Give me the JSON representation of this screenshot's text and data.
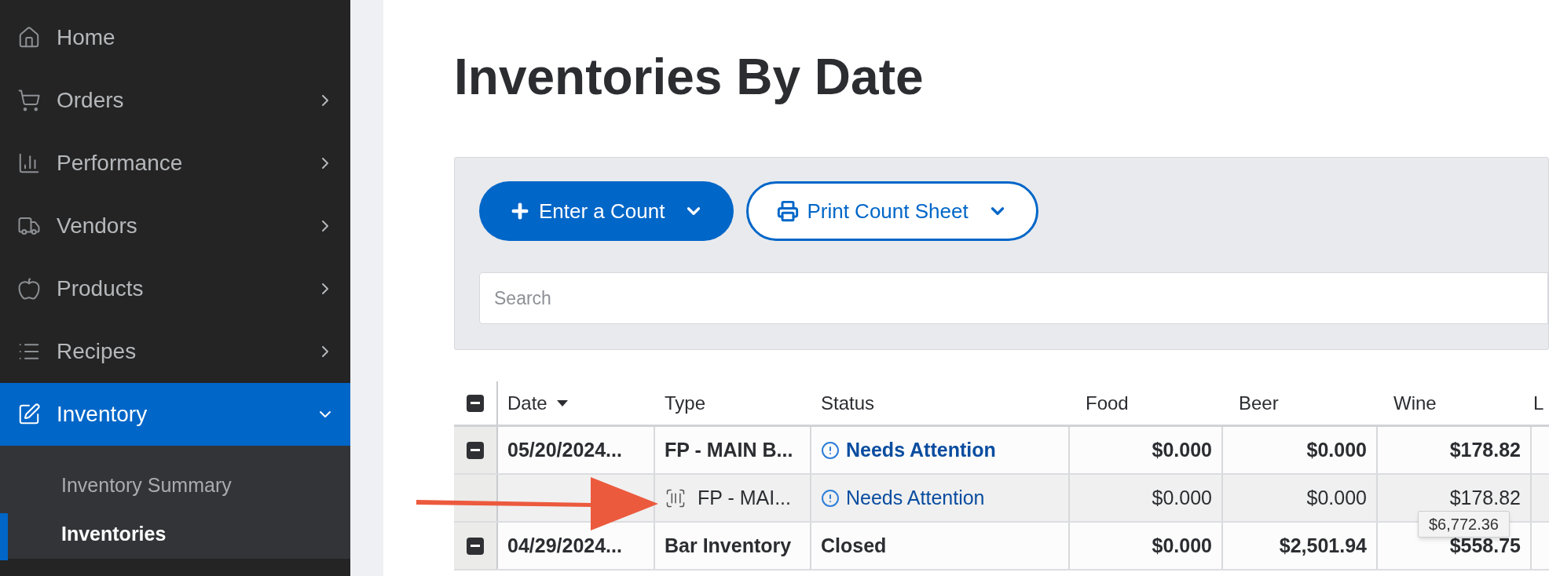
{
  "sidebar": {
    "items": [
      {
        "label": "Home",
        "expandable": false,
        "selected": false
      },
      {
        "label": "Orders",
        "expandable": true,
        "expanded": false,
        "selected": false
      },
      {
        "label": "Performance",
        "expandable": true,
        "expanded": false,
        "selected": false
      },
      {
        "label": "Vendors",
        "expandable": true,
        "expanded": false,
        "selected": false
      },
      {
        "label": "Products",
        "expandable": true,
        "expanded": false,
        "selected": false
      },
      {
        "label": "Recipes",
        "expandable": true,
        "expanded": false,
        "selected": false
      },
      {
        "label": "Inventory",
        "expandable": true,
        "expanded": true,
        "selected": true,
        "children": [
          {
            "label": "Inventory Summary",
            "selected": false
          },
          {
            "label": "Inventories",
            "selected": true
          }
        ]
      }
    ]
  },
  "page": {
    "title": "Inventories By Date"
  },
  "toolbar": {
    "buttons": [
      {
        "label": "Enter a Count",
        "kind": "primary"
      },
      {
        "label": "Print Count Sheet",
        "kind": "outline"
      }
    ],
    "search": {
      "placeholder": "Search"
    }
  },
  "table": {
    "columns": [
      "Date",
      "Type",
      "Status",
      "Food",
      "Beer",
      "Wine",
      "L"
    ],
    "rows": [
      {
        "kind": "parent",
        "date": "05/20/2024...",
        "type": "FP - MAIN B...",
        "status": "Needs Attention",
        "attention": true,
        "food": "$0.000",
        "beer": "$0.000",
        "wine": "$178.82"
      },
      {
        "kind": "child",
        "type": "FP - MAI...",
        "status": "Needs Attention",
        "attention": true,
        "food": "$0.000",
        "beer": "$0.000",
        "wine": "$178.82",
        "tooltip": "$6,772.36"
      },
      {
        "kind": "parent",
        "date": "04/29/2024...",
        "type": "Bar Inventory",
        "status": "Closed",
        "attention": false,
        "food": "$0.000",
        "beer": "$2,501.94",
        "wine": "$558.75"
      }
    ]
  }
}
